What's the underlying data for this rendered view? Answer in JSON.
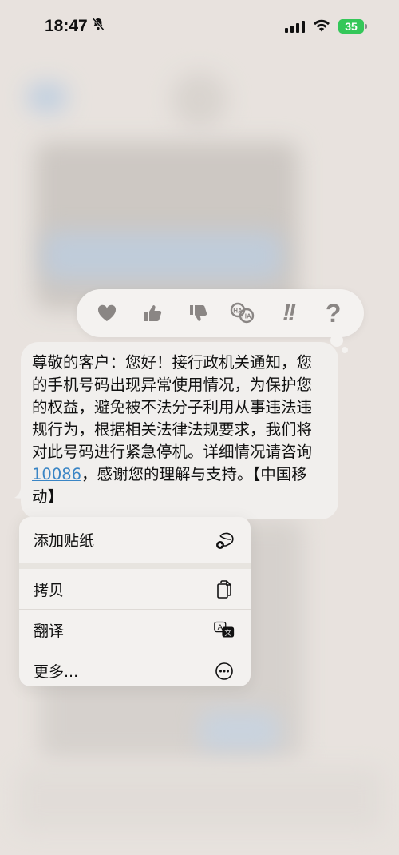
{
  "status_bar": {
    "time": "18:47",
    "battery": "35",
    "icons": [
      "bell-slash-icon",
      "signal-icon",
      "wifi-icon",
      "battery-icon"
    ]
  },
  "tapback": {
    "reactions": [
      "heart-icon",
      "thumbs-up-icon",
      "thumbs-down-icon",
      "haha-icon",
      "exclamation-icon",
      "question-icon"
    ],
    "haha_text": "HA HA",
    "exclamation_text": "!!",
    "question_text": "?"
  },
  "message": {
    "text_before_link": "尊敬的客户：您好！接行政机关通知，您的手机号码出现异常使用情况，为保护您的权益，避免被不法分子利用从事违法违规行为，根据相关法律法规要求，我们将对此号码进行紧急停机。详细情况请咨询",
    "link_text": "10086",
    "text_after_link": "，感谢您的理解与支持。【中国移动】"
  },
  "menu": {
    "items": [
      {
        "label": "添加贴纸",
        "icon": "add-sticker-icon"
      },
      {
        "label": "拷贝",
        "icon": "copy-icon"
      },
      {
        "label": "翻译",
        "icon": "translate-icon"
      },
      {
        "label": "更多...",
        "icon": "more-icon"
      }
    ],
    "translate_icon_letter_a": "A",
    "translate_icon_letter_b": "文"
  },
  "colors": {
    "background": "#e6e1dc",
    "bubble": "#f1efed",
    "link": "#3a85c5",
    "battery": "#34c759",
    "icon": "#8a8684"
  }
}
